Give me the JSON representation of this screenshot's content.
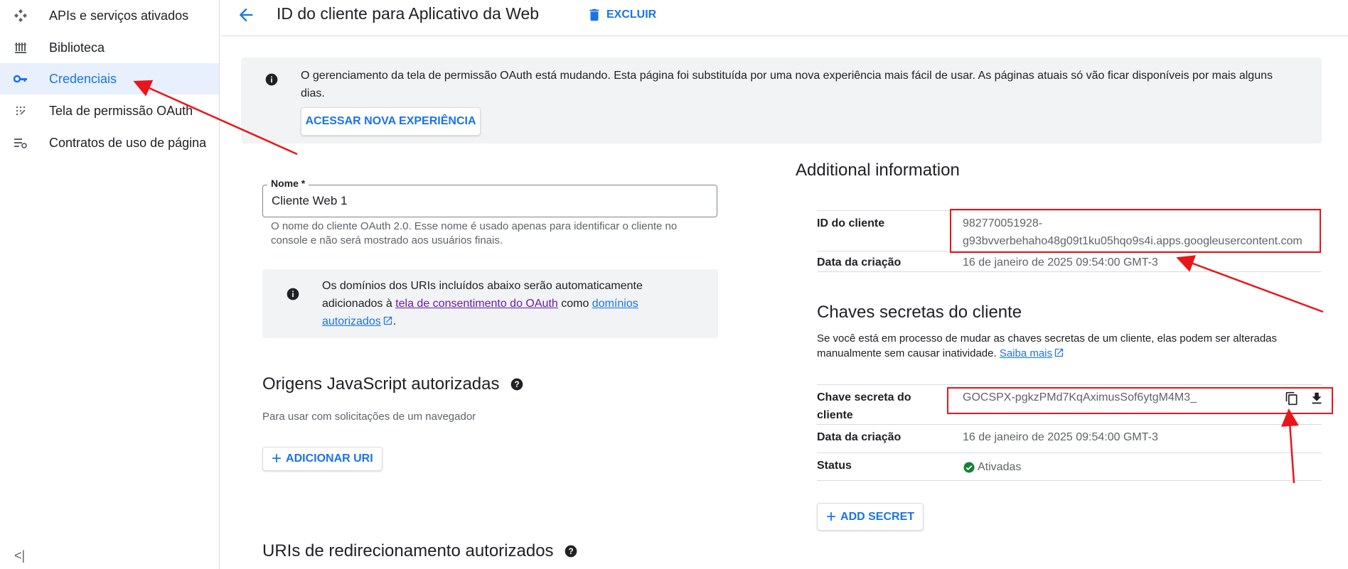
{
  "sidebar": {
    "items": [
      {
        "label": "APIs e serviços ativados",
        "icon": "apis-services-icon"
      },
      {
        "label": "Biblioteca",
        "icon": "library-icon"
      },
      {
        "label": "Credenciais",
        "icon": "key-icon",
        "active": true
      },
      {
        "label": "Tela de permissão OAuth",
        "icon": "oauth-consent-icon"
      },
      {
        "label": "Contratos de uso de página",
        "icon": "page-usage-icon"
      }
    ],
    "collapse_label": "<|"
  },
  "header": {
    "title": "ID do cliente para Aplicativo da Web",
    "delete_label": "EXCLUIR"
  },
  "banner": {
    "text": "O gerenciamento da tela de permissão OAuth está mudando. Esta página foi substituída por uma nova experiência mais fácil de usar. As páginas atuais só vão ficar disponíveis por mais alguns dias.",
    "button_label": "ACESSAR NOVA EXPERIÊNCIA"
  },
  "name_field": {
    "label": "Nome *",
    "value": "Cliente Web 1",
    "help": "O nome do cliente OAuth 2.0. Esse nome é usado apenas para identificar o cliente no console e não será mostrado aos usuários finais."
  },
  "domains_info": {
    "text_before": "Os domínios dos URIs incluídos abaixo serão automaticamente adicionados à ",
    "link1": "tela de consentimento do OAuth",
    "text_middle": " como ",
    "link2": "domínios autorizados",
    "text_after": "."
  },
  "js_origins": {
    "title": "Origens JavaScript autorizadas",
    "subtitle": "Para usar com solicitações de um navegador",
    "add_label": "ADICIONAR URI"
  },
  "redirect_uris": {
    "title": "URIs de redirecionamento autorizados"
  },
  "additional_info": {
    "title": "Additional information",
    "client_id_label": "ID do cliente",
    "client_id_line1": "982770051928-",
    "client_id_line2": "g93bvverbehaho48g09t1ku05hqo9s4i.apps.googleusercontent.com",
    "created_label": "Data da criação",
    "created_value": "16 de janeiro de 2025 09:54:00 GMT-3"
  },
  "secrets": {
    "title": "Chaves secretas do cliente",
    "desc": "Se você está em processo de mudar as chaves secretas de um cliente, elas podem ser alteradas manualmente sem causar inatividade. ",
    "learn_more": "Saiba mais",
    "secret_label_line1": "Chave secreta do",
    "secret_label_line2": "cliente",
    "secret_value": "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",
    "created_label": "Data da criação",
    "created_value": "16 de janeiro de 2025 09:54:00 GMT-3",
    "status_label": "Status",
    "status_value": "Ativadas",
    "add_label": "ADD SECRET"
  },
  "colors": {
    "accent": "#1a73e8",
    "annotation_red": "#e8161b",
    "status_green": "#188038"
  }
}
